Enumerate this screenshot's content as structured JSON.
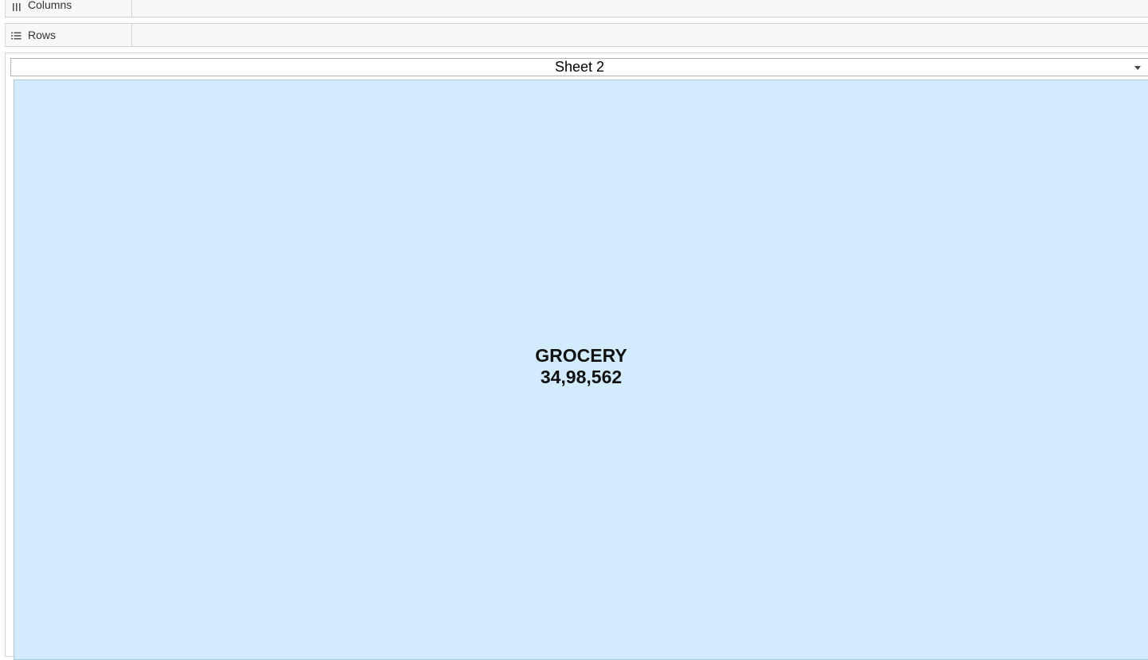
{
  "shelves": {
    "columns": {
      "label": "Columns",
      "icon": "columns-icon"
    },
    "rows": {
      "label": "Rows",
      "icon": "rows-icon"
    }
  },
  "sheet": {
    "title": "Sheet 2"
  },
  "chart_data": {
    "type": "treemap",
    "tiles": [
      {
        "category": "GROCERY",
        "value_label": "34,98,562",
        "value": 3498562,
        "color": "#d3ecfd"
      }
    ]
  },
  "colors": {
    "tile": "#d3ecfd",
    "shelf_bg": "#f8f8f8",
    "border": "#d4d4d4"
  }
}
